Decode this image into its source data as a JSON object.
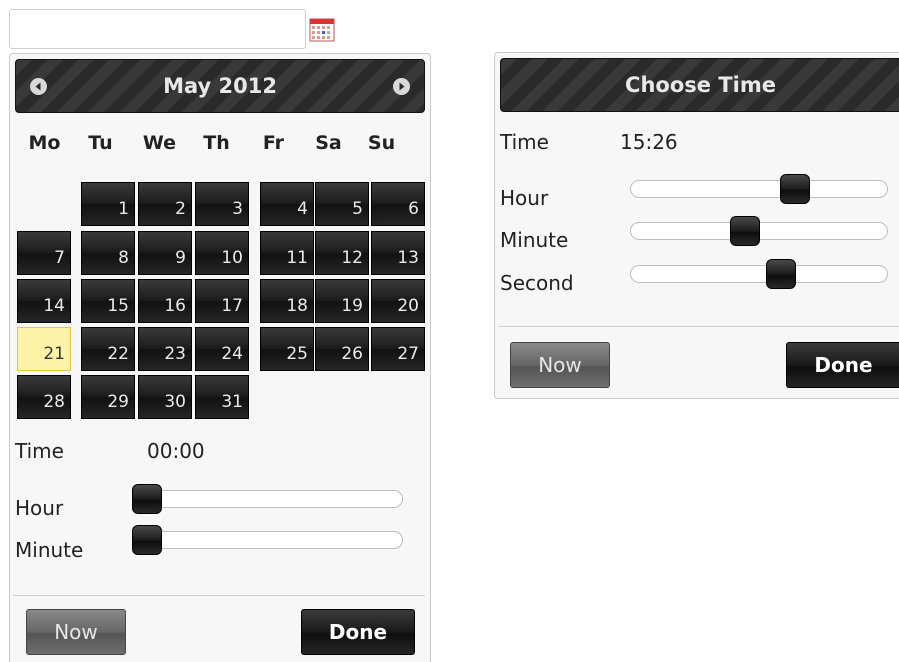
{
  "date_input": {
    "value": ""
  },
  "datepicker": {
    "month_year": "May 2012",
    "weekdays": [
      "Mo",
      "Tu",
      "We",
      "Th",
      "Fr",
      "Sa",
      "Su"
    ],
    "days": [
      "1",
      "2",
      "3",
      "4",
      "5",
      "6",
      "7",
      "8",
      "9",
      "10",
      "11",
      "12",
      "13",
      "14",
      "15",
      "16",
      "17",
      "18",
      "19",
      "20",
      "21",
      "22",
      "23",
      "24",
      "25",
      "26",
      "27",
      "28",
      "29",
      "30",
      "31"
    ],
    "selected_day": "21",
    "time_label": "Time",
    "time_value": "00:00",
    "hour_label": "Hour",
    "minute_label": "Minute",
    "hour_value": 0,
    "minute_value": 0,
    "now_label": "Now",
    "done_label": "Done"
  },
  "timepicker": {
    "title": "Choose Time",
    "time_label": "Time",
    "time_value": "15:26",
    "hour_label": "Hour",
    "minute_label": "Minute",
    "second_label": "Second",
    "hour_value": 15,
    "minute_value": 26,
    "second_value": 35,
    "now_label": "Now",
    "done_label": "Done"
  },
  "colors": {
    "header_bg": "#2a2a2a",
    "day_bg": "#1c1c1c",
    "selected_day_bg": "#fdf3a6",
    "panel_bg": "#f7f7f7"
  }
}
